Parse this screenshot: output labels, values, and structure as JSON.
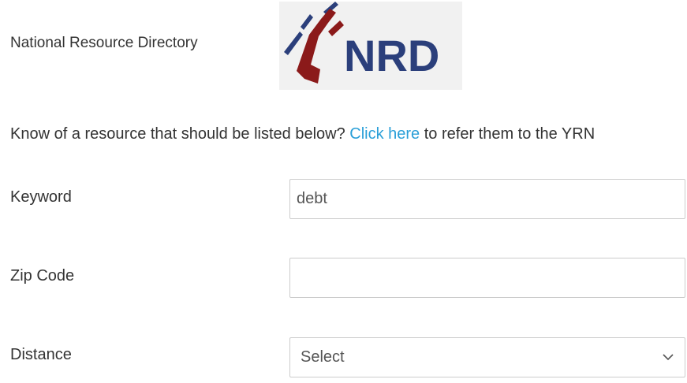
{
  "header": {
    "title": "National Resource Directory",
    "logo": {
      "text": "NRD",
      "text_color": "#2b3f7b",
      "mark_blue": "#2b3f7b",
      "mark_red": "#8b1a1a",
      "background": "#f1f1f1"
    }
  },
  "intro": {
    "before": "Know of a resource that should be listed below? ",
    "link": "Click here",
    "after": " to refer them to the YRN",
    "link_color": "#2a9fd8"
  },
  "form": {
    "keyword": {
      "label": "Keyword",
      "value": "debt",
      "placeholder": ""
    },
    "zip": {
      "label": "Zip Code",
      "value": "",
      "placeholder": ""
    },
    "distance": {
      "label": "Distance",
      "selected": "Select"
    }
  }
}
